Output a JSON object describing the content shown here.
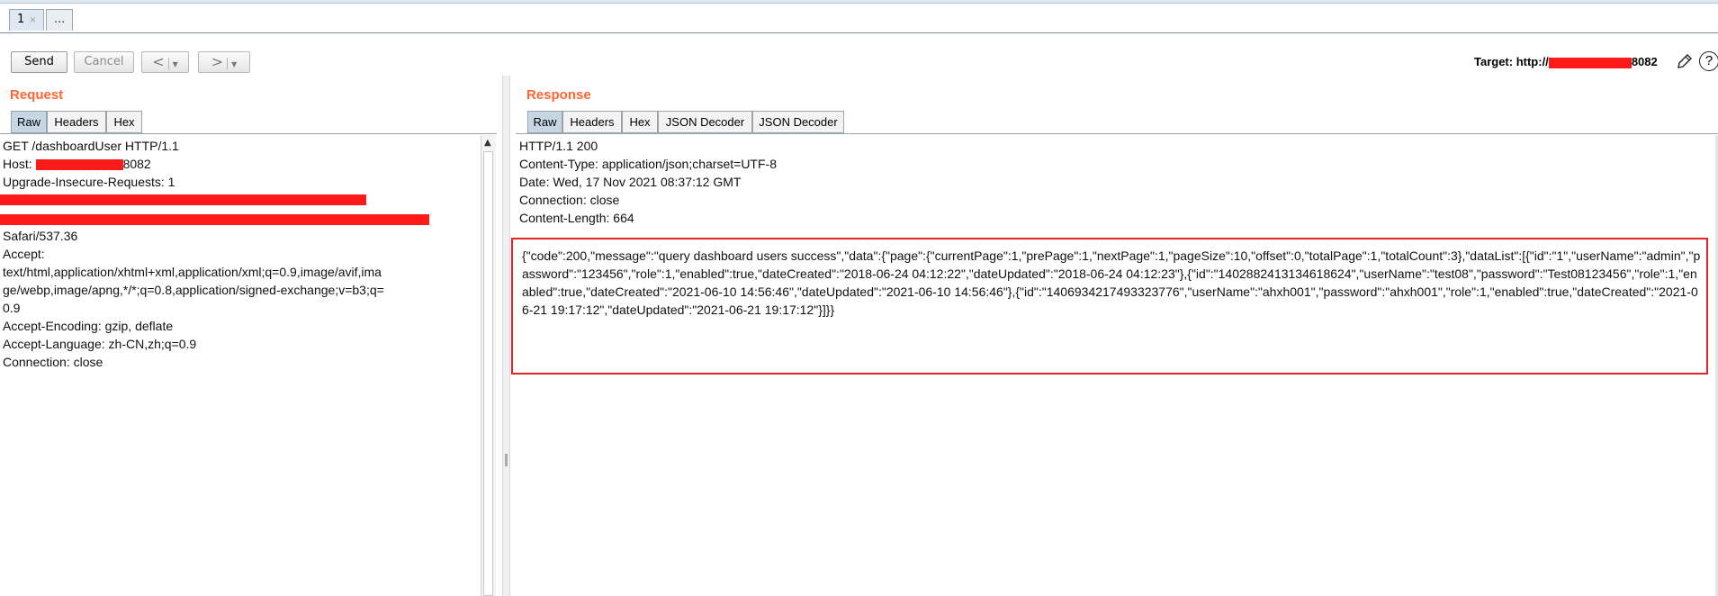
{
  "tabs": [
    {
      "label": "1",
      "close": "×"
    },
    {
      "label": "..."
    }
  ],
  "toolbar": {
    "send": "Send",
    "cancel": "Cancel",
    "back_arrow": "<",
    "forward_arrow": ">",
    "dropdown": "▼"
  },
  "target": {
    "prefix": "Target: http://",
    "suffix": "8082",
    "help": "?"
  },
  "request": {
    "title": "Request",
    "tabs": [
      "Raw",
      "Headers",
      "Hex"
    ],
    "active_tab": "Raw",
    "lines": {
      "l1": "GET /dashboardUser HTTP/1.1",
      "host_prefix": "Host: ",
      "host_suffix": "8082",
      "l3": "Upgrade-Insecure-Requests: 1",
      "l6": "Safari/537.36",
      "l7": "Accept:",
      "l8": "text/html,application/xhtml+xml,application/xml;q=0.9,image/avif,ima",
      "l9": "ge/webp,image/apng,*/*;q=0.8,application/signed-exchange;v=b3;q=",
      "l10": "0.9",
      "l11": "Accept-Encoding: gzip, deflate",
      "l12": "Accept-Language: zh-CN,zh;q=0.9",
      "l13": "Connection: close"
    }
  },
  "response": {
    "title": "Response",
    "tabs": [
      "Raw",
      "Headers",
      "Hex",
      "JSON Decoder",
      "JSON Decoder"
    ],
    "active_tab": "Raw",
    "headers": [
      "HTTP/1.1 200",
      "Content-Type: application/json;charset=UTF-8",
      "Date: Wed, 17 Nov 2021 08:37:12 GMT",
      "Connection: close",
      "Content-Length: 664"
    ],
    "body": "{\"code\":200,\"message\":\"query dashboard users success\",\"data\":{\"page\":{\"currentPage\":1,\"prePage\":1,\"nextPage\":1,\"pageSize\":10,\"offset\":0,\"totalPage\":1,\"totalCount\":3},\"dataList\":[{\"id\":\"1\",\"userName\":\"admin\",\"password\":\"123456\",\"role\":1,\"enabled\":true,\"dateCreated\":\"2018-06-24 04:12:22\",\"dateUpdated\":\"2018-06-24 04:12:23\"},{\"id\":\"1402882413134618624\",\"userName\":\"test08\",\"password\":\"Test08123456\",\"role\":1,\"enabled\":true,\"dateCreated\":\"2021-06-10 14:56:46\",\"dateUpdated\":\"2021-06-10 14:56:46\"},{\"id\":\"1406934217493323776\",\"userName\":\"ahxh001\",\"password\":\"ahxh001\",\"role\":1,\"enabled\":true,\"dateCreated\":\"2021-06-21 19:17:12\",\"dateUpdated\":\"2021-06-21 19:17:12\"}]}}"
  },
  "colors": {
    "accent": "#ff6633",
    "redaction": "#ff1a1a",
    "highlight_border": "#e32424",
    "active_tab": "#c7d6e3"
  }
}
